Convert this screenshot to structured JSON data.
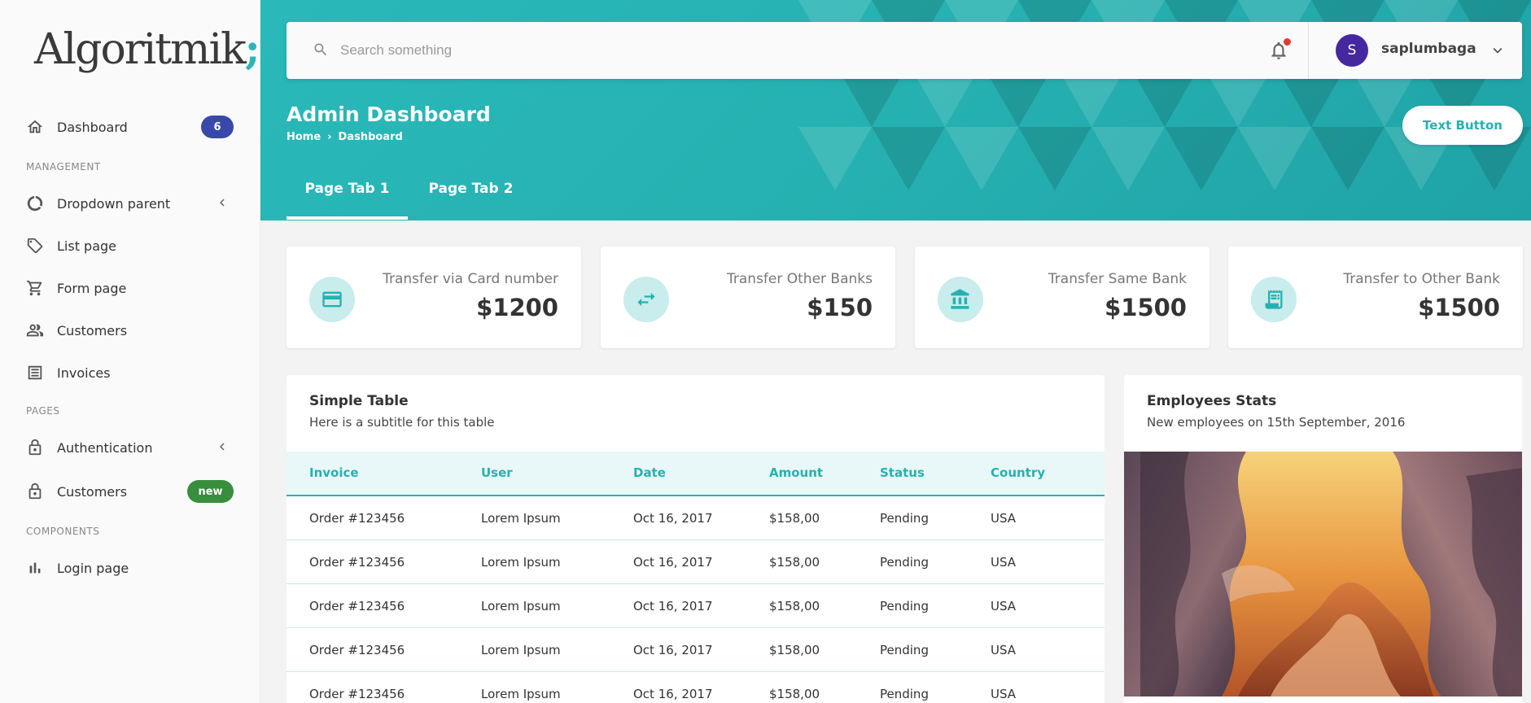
{
  "app": {
    "logo_text": "Algoritmik",
    "logo_suffix": ";"
  },
  "sidebar": {
    "dashboard": {
      "label": "Dashboard",
      "badge": "6"
    },
    "section_management": "MANAGEMENT",
    "dropdown_parent": "Dropdown parent",
    "list_page": "List page",
    "form_page": "Form page",
    "customers": "Customers",
    "invoices": "Invoices",
    "section_pages": "PAGES",
    "authentication": "Authentication",
    "customers2": {
      "label": "Customers",
      "badge": "new"
    },
    "section_components": "COMPONENTS",
    "login_page": "Login page"
  },
  "topbar": {
    "search_placeholder": "Search something",
    "avatar_initial": "S",
    "username": "saplumbaga"
  },
  "header": {
    "title": "Admin Dashboard",
    "breadcrumb": [
      "Home",
      "Dashboard"
    ],
    "breadcrumb_sep": "›",
    "action_button": "Text Button",
    "tabs": [
      "Page Tab 1",
      "Page Tab 2"
    ]
  },
  "stats": [
    {
      "label": "Transfer via Card number",
      "value": "$1200",
      "icon": "credit-card-icon"
    },
    {
      "label": "Transfer Other Banks",
      "value": "$150",
      "icon": "swap-arrows-icon"
    },
    {
      "label": "Transfer Same Bank",
      "value": "$1500",
      "icon": "bank-icon"
    },
    {
      "label": "Transfer to Other Bank",
      "value": "$1500",
      "icon": "receipt-icon"
    }
  ],
  "table": {
    "title": "Simple Table",
    "subtitle": "Here is a subtitle for this table",
    "columns": [
      "Invoice",
      "User",
      "Date",
      "Amount",
      "Status",
      "Country"
    ],
    "rows": [
      [
        "Order #123456",
        "Lorem Ipsum",
        "Oct 16, 2017",
        "$158,00",
        "Pending",
        "USA"
      ],
      [
        "Order #123456",
        "Lorem Ipsum",
        "Oct 16, 2017",
        "$158,00",
        "Pending",
        "USA"
      ],
      [
        "Order #123456",
        "Lorem Ipsum",
        "Oct 16, 2017",
        "$158,00",
        "Pending",
        "USA"
      ],
      [
        "Order #123456",
        "Lorem Ipsum",
        "Oct 16, 2017",
        "$158,00",
        "Pending",
        "USA"
      ],
      [
        "Order #123456",
        "Lorem Ipsum",
        "Oct 16, 2017",
        "$158,00",
        "Pending",
        "USA"
      ]
    ]
  },
  "employees": {
    "title": "Employees Stats",
    "subtitle": "New employees on 15th September, 2016"
  },
  "colors": {
    "accent": "#26b1b1",
    "badge_blue": "#3949ab",
    "badge_green": "#388e3c",
    "avatar": "#4527a0",
    "notification_dot": "#e53935"
  }
}
